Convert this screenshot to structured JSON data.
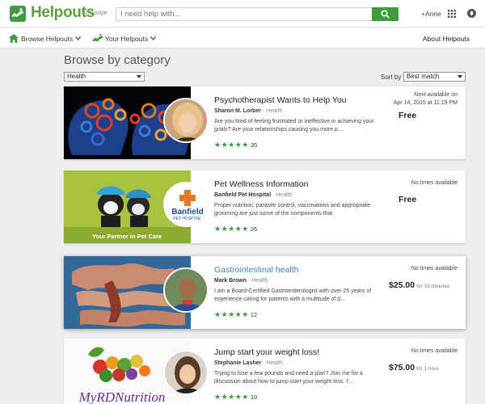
{
  "header": {
    "logo_text": "Helpouts",
    "logo_sub": "by Google",
    "search_placeholder": "I need help with...",
    "user_name": "+Anne",
    "brand_color": "#3f9b3c"
  },
  "nav": {
    "browse_label": "Browse Helpouts",
    "yours_label": "Your Helpouts",
    "about_label": "About Helpouts"
  },
  "browse": {
    "title": "Browse by category",
    "category_selected": "Health",
    "sort_label": "Sort by",
    "sort_selected": "Best match"
  },
  "cards": [
    {
      "title": "Psychotherapist Wants to Help You",
      "author": "Sharon M. Lorber",
      "category": "· Health",
      "description": "Are you tired of feeling frustrated or ineffective in achieving your goals? Are your relationships causing you more p...",
      "rating_stars": 5,
      "rating_count": "35",
      "availability_line1": "Next available on",
      "availability_line2": "Apr 14, 2015 at 11:15 PM",
      "price": "Free",
      "price_per": ""
    },
    {
      "title": "Pet Wellness Information",
      "author": "Banfield Pet Hospital",
      "category": "· Health",
      "description": "Proper nutrition, parasite control, vaccinations and appropriate grooming are just some of the components that",
      "rating_stars": 5,
      "rating_count": "26",
      "availability_line1": "No times available",
      "availability_line2": "",
      "price": "Free",
      "price_per": "",
      "thumb_caption": "Your Partner in Pet Care",
      "logo_name": "Banfield",
      "logo_sub": "PET HOSPITAL"
    },
    {
      "title": "Gastrointestinal health",
      "author": "Mark Brown",
      "category": "· Health",
      "description": "I am a Board-Certified Gastroenterologist  with over 25 years of experience caring for patients with a multitude of d...",
      "rating_stars": 5,
      "rating_count": "12",
      "availability_line1": "No times available",
      "availability_line2": "",
      "price": "$25.00",
      "price_per": "for 15 minutes"
    },
    {
      "title": "Jump start your weight loss!",
      "author": "Stephanie Lasher",
      "category": "· Health",
      "description": "Trying to lose a few pounds and need a plan?  Join me for a discussion about how to jump start your weight loss.  I'...",
      "rating_stars": 5,
      "rating_count": "10",
      "availability_line1": "No times available",
      "availability_line2": "",
      "price": "$75.00",
      "price_per": "for 1 hour",
      "thumb_caption": "MyRDNutrition"
    }
  ]
}
